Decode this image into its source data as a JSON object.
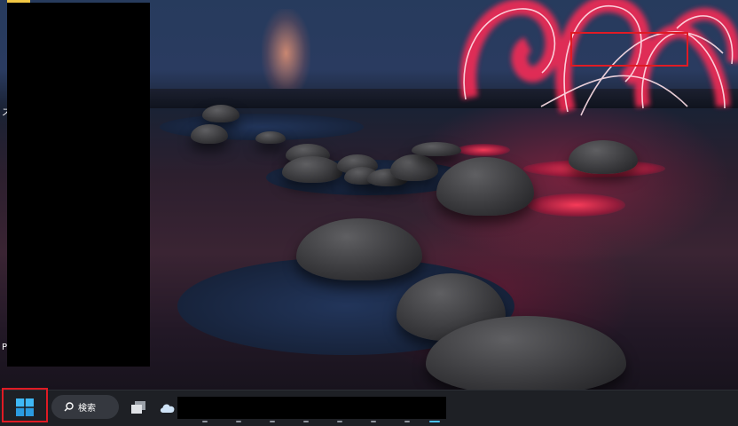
{
  "desktop": {
    "side_text_top": "ス",
    "side_text_bottom": "P",
    "accent": "#e01b24"
  },
  "taskbar": {
    "start_icon": "windows-logo-icon",
    "search_icon": "search-icon",
    "search_label": "検索",
    "task_view_icon": "task-view-icon",
    "widgets_icon": "weather-cloud-icon",
    "active_indicator_color": "#4cc2ff"
  }
}
